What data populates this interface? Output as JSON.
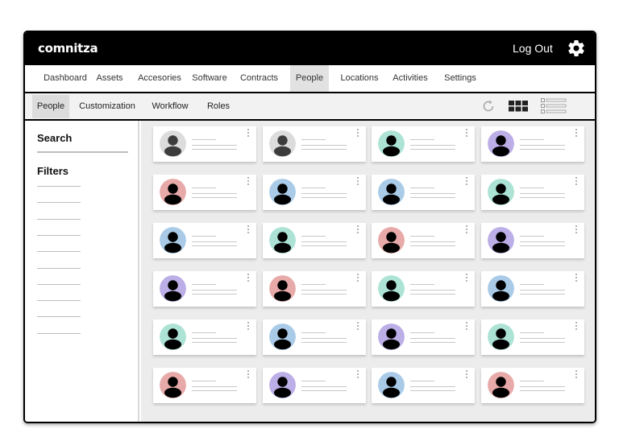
{
  "header": {
    "logo": "comnitza",
    "logout_label": "Log Out",
    "settings_icon": "gear-icon"
  },
  "main_nav": {
    "items": [
      {
        "label": "Dashboard",
        "active": false
      },
      {
        "label": "Assets",
        "active": false
      },
      {
        "label": "Accesories",
        "active": false
      },
      {
        "label": "Software",
        "active": false
      },
      {
        "label": "Contracts",
        "active": false
      },
      {
        "label": "People",
        "active": true
      },
      {
        "label": "Locations",
        "active": false
      },
      {
        "label": "Activities",
        "active": false
      },
      {
        "label": "Settings",
        "active": false
      }
    ]
  },
  "sub_nav": {
    "items": [
      {
        "label": "People",
        "active": true
      },
      {
        "label": "Customization",
        "active": false
      },
      {
        "label": "Workflow",
        "active": false
      },
      {
        "label": "Roles",
        "active": false
      }
    ],
    "tools": [
      "refresh-icon",
      "grid-view-icon",
      "list-view-icon"
    ]
  },
  "sidebar": {
    "search_label": "Search",
    "filters_label": "Filters",
    "filter_count": 10
  },
  "colors": {
    "gray": "#dcdcdc",
    "green": "#ace3d5",
    "purple": "#bcaee6",
    "pink": "#e8aaa9",
    "blue": "#a9cbe8"
  },
  "people_grid": {
    "rows": [
      [
        "gray",
        "gray",
        "green",
        "purple"
      ],
      [
        "pink",
        "blue",
        "blue",
        "green"
      ],
      [
        "blue",
        "green",
        "pink",
        "purple"
      ],
      [
        "purple",
        "pink",
        "green",
        "blue"
      ],
      [
        "green",
        "blue",
        "purple",
        "green"
      ],
      [
        "pink",
        "purple",
        "blue",
        "pink"
      ]
    ]
  }
}
